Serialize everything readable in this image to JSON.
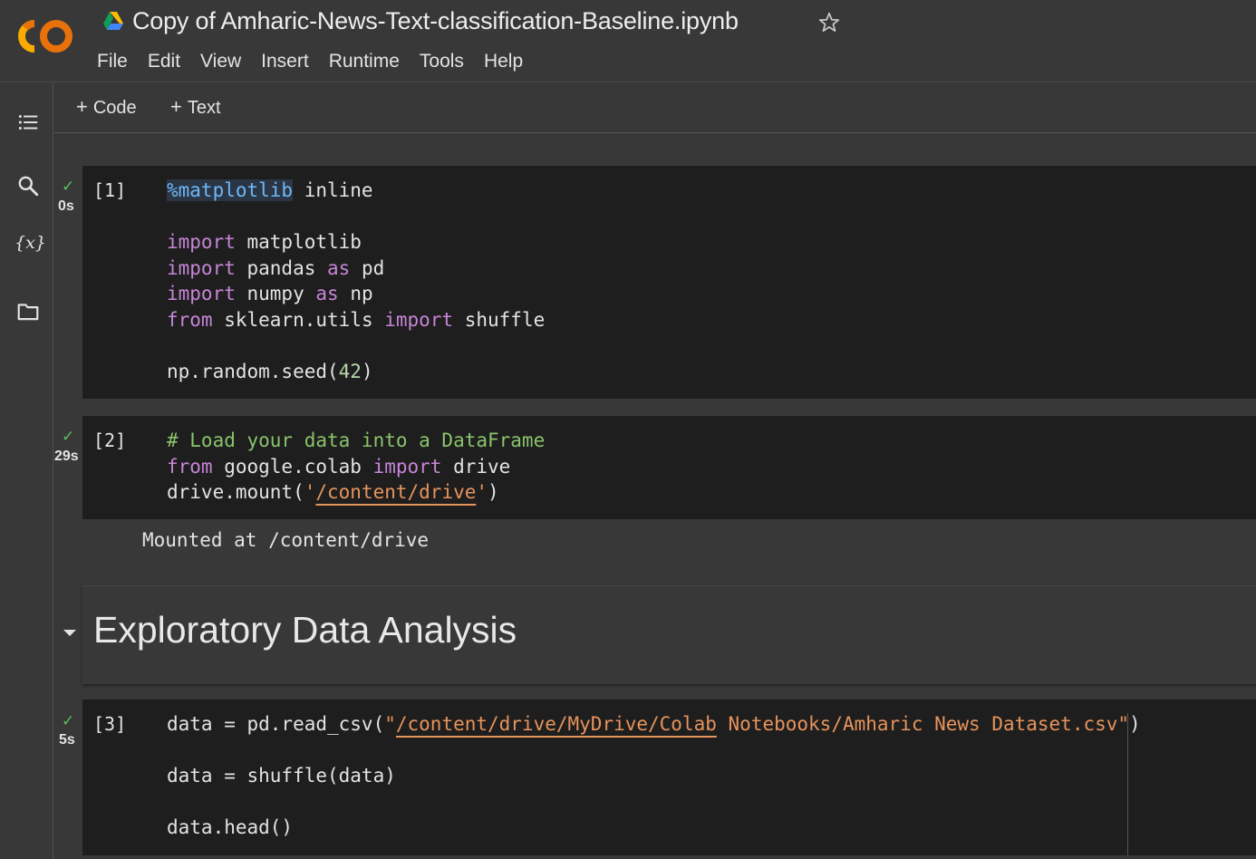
{
  "header": {
    "doc_title": "Copy of Amharic-News-Text-classification-Baseline.ipynb",
    "menu": [
      "File",
      "Edit",
      "View",
      "Insert",
      "Runtime",
      "Tools",
      "Help"
    ]
  },
  "sidebar": {
    "icons": [
      "table-of-contents-icon",
      "search-icon",
      "variables-icon",
      "folder-icon"
    ],
    "variables_label": "{x}"
  },
  "toolbar": {
    "add_code_label": "Code",
    "add_text_label": "Text",
    "plus_glyph": "+"
  },
  "cells": [
    {
      "exec_count": "[1]",
      "status": "✓",
      "duration": "0s",
      "lines": [
        [
          {
            "t": "%matplotlib",
            "c": "mag"
          },
          {
            "t": " inline"
          }
        ],
        [],
        [
          {
            "t": "import",
            "c": "kw"
          },
          {
            "t": " matplotlib"
          }
        ],
        [
          {
            "t": "import",
            "c": "kw"
          },
          {
            "t": " pandas "
          },
          {
            "t": "as",
            "c": "kw"
          },
          {
            "t": " pd"
          }
        ],
        [
          {
            "t": "import",
            "c": "kw"
          },
          {
            "t": " numpy "
          },
          {
            "t": "as",
            "c": "kw"
          },
          {
            "t": " np"
          }
        ],
        [
          {
            "t": "from",
            "c": "kw"
          },
          {
            "t": " sklearn.utils "
          },
          {
            "t": "import",
            "c": "kw"
          },
          {
            "t": " shuffle"
          }
        ],
        [],
        [
          {
            "t": "np.random.seed("
          },
          {
            "t": "42",
            "c": "num"
          },
          {
            "t": ")"
          }
        ]
      ]
    },
    {
      "exec_count": "[2]",
      "status": "✓",
      "duration": "29s",
      "lines": [
        [
          {
            "t": "# Load your data into a DataFrame",
            "c": "cm"
          }
        ],
        [
          {
            "t": "from",
            "c": "kw"
          },
          {
            "t": " google.colab "
          },
          {
            "t": "import",
            "c": "kw"
          },
          {
            "t": " drive"
          }
        ],
        [
          {
            "t": "drive.mount("
          },
          {
            "t": "'",
            "c": "str"
          },
          {
            "t": "/content/drive",
            "c": "str link"
          },
          {
            "t": "'",
            "c": "str"
          },
          {
            "t": ")"
          }
        ]
      ],
      "output": "Mounted at /content/drive"
    },
    {
      "exec_count": "[3]",
      "status": "✓",
      "duration": "5s",
      "lines": [
        [
          {
            "t": "data = pd.read_csv("
          },
          {
            "t": "\"",
            "c": "str"
          },
          {
            "t": "/content/drive/MyDrive/Colab",
            "c": "str link"
          },
          {
            "t": " Notebooks/Amharic News Dataset.csv\"",
            "c": "str"
          },
          {
            "t": ")"
          }
        ],
        [],
        [
          {
            "t": "data = shuffle(data)"
          }
        ],
        [],
        [
          {
            "t": "data.head()"
          }
        ]
      ]
    }
  ],
  "text_cell": {
    "heading": "Exploratory Data Analysis"
  },
  "colors": {
    "background": "#383838",
    "cell_bg": "#1e1e1e",
    "keyword": "#c785d8",
    "string": "#e6935c",
    "comment": "#89c46b",
    "magic": "#6db8f7",
    "success": "#5cbd5c",
    "logo_orange": "#f9ab00",
    "logo_dark_orange": "#e8710a"
  }
}
